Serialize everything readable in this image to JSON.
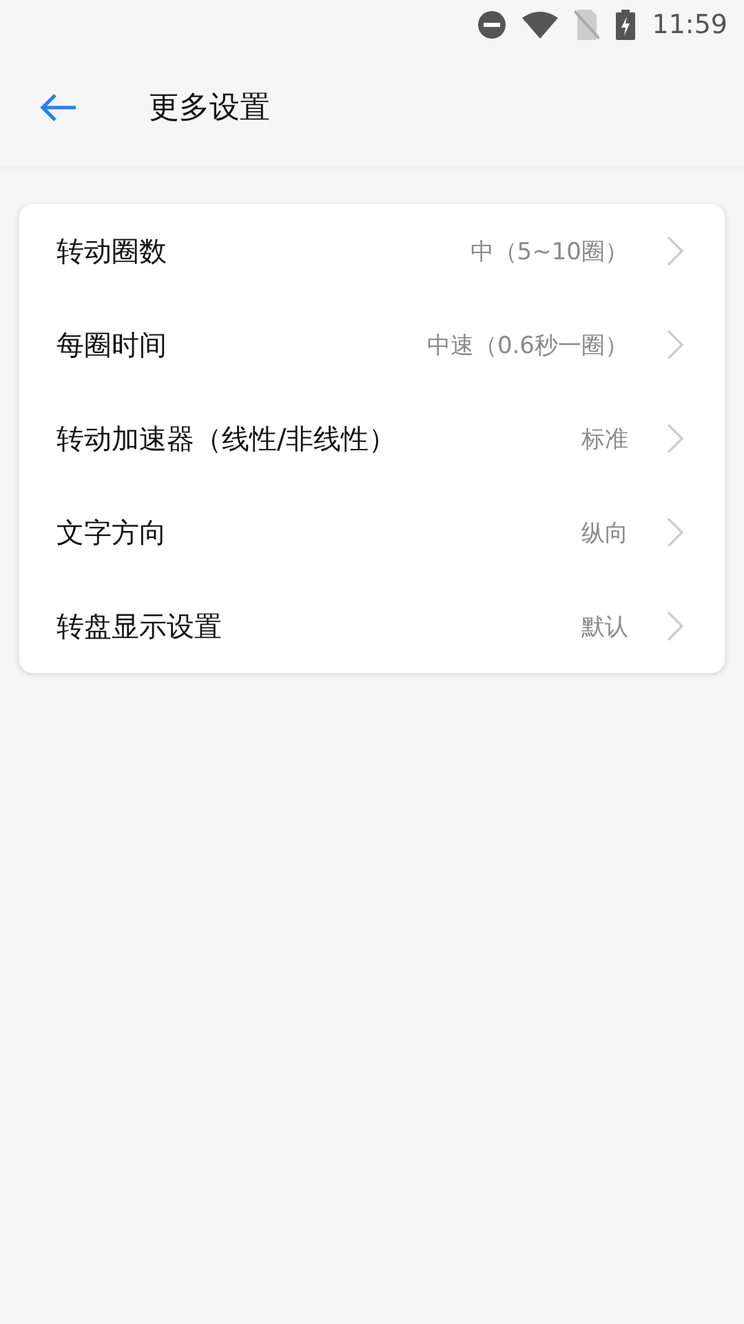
{
  "status_bar": {
    "time": "11:59"
  },
  "header": {
    "title": "更多设置"
  },
  "settings": [
    {
      "label": "转动圈数",
      "value": "中（5~10圈）"
    },
    {
      "label": "每圈时间",
      "value": "中速（0.6秒一圈）"
    },
    {
      "label": "转动加速器（线性/非线性）",
      "value": "标准"
    },
    {
      "label": "文字方向",
      "value": "纵向"
    },
    {
      "label": "转盘显示设置",
      "value": "默认"
    }
  ]
}
